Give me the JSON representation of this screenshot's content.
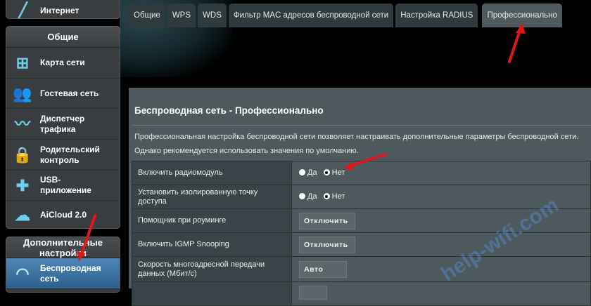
{
  "sidebar": {
    "internet_label": "Интернет",
    "general_header": "Общие",
    "items": [
      {
        "label": "Карта сети",
        "icon": "network-map-icon"
      },
      {
        "label": "Гостевая сеть",
        "icon": "guest-network-icon"
      },
      {
        "label": "Диспетчер трафика",
        "icon": "traffic-manager-icon"
      },
      {
        "label": "Родительский контроль",
        "icon": "lock-icon"
      },
      {
        "label": "USB-приложение",
        "icon": "puzzle-icon"
      },
      {
        "label": "AiCloud 2.0",
        "icon": "cloud-home-icon"
      }
    ],
    "advanced_header": "Дополнительные настройки",
    "wireless_label": "Беспроводная сеть"
  },
  "tabs": [
    "Общие",
    "WPS",
    "WDS",
    "Фильтр MAC адресов беспроводной сети",
    "Настройка RADIUS",
    "Профессионально"
  ],
  "active_tab": "Профессионально",
  "content": {
    "title": "Беспроводная сеть - Профессионально",
    "desc1": "Профессиональная настройка беспроводной сети позволяет настраивать дополнительные параметры беспроводной сети.",
    "desc2": "Однако рекомендуется использовать значения по умолчанию.",
    "rows": [
      {
        "label": "Включить радиомодуль",
        "yes": "Да",
        "no": "Нет",
        "selected": "Нет"
      },
      {
        "label": "Установить изолированную точку доступа",
        "yes": "Да",
        "no": "Нет",
        "selected": "Нет"
      },
      {
        "label": "Помощник при роуминге",
        "value": "Отключить"
      },
      {
        "label": "Включить IGMP Snooping",
        "value": "Отключить"
      },
      {
        "label": "Скорость многоадресной передачи данных (Мбит/с)",
        "value": "Авто"
      }
    ]
  },
  "watermark": "help-wifi.com",
  "colors": {
    "accent": "#4f87b6",
    "arrow": "#e0161b",
    "icon": "#6cd0ea"
  }
}
